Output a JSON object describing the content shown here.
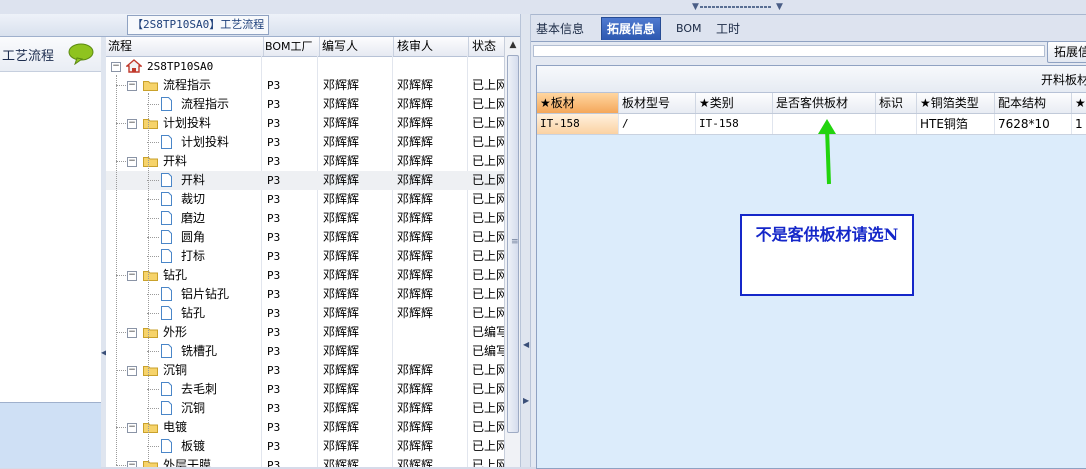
{
  "window": {
    "flow_title": "【2S8TP10SA0】工艺流程"
  },
  "left_panel": {
    "label": "工艺流程"
  },
  "grid": {
    "columns": [
      "流程",
      "BOM工厂",
      "编写人",
      "核审人",
      "状态"
    ],
    "rows": [
      {
        "name": "2S8TP10SA0",
        "bom": "",
        "writer": "",
        "reviewer": "",
        "status": ""
      },
      {
        "name": "流程指示",
        "bom": "P3",
        "writer": "邓辉辉",
        "reviewer": "邓辉辉",
        "status": "已上网"
      },
      {
        "name": "流程指示",
        "bom": "P3",
        "writer": "邓辉辉",
        "reviewer": "邓辉辉",
        "status": "已上网"
      },
      {
        "name": "计划投料",
        "bom": "P3",
        "writer": "邓辉辉",
        "reviewer": "邓辉辉",
        "status": "已上网"
      },
      {
        "name": "计划投料",
        "bom": "P3",
        "writer": "邓辉辉",
        "reviewer": "邓辉辉",
        "status": "已上网"
      },
      {
        "name": "开料",
        "bom": "P3",
        "writer": "邓辉辉",
        "reviewer": "邓辉辉",
        "status": "已上网"
      },
      {
        "name": "开料",
        "bom": "P3",
        "writer": "邓辉辉",
        "reviewer": "邓辉辉",
        "status": "已上网"
      },
      {
        "name": "裁切",
        "bom": "P3",
        "writer": "邓辉辉",
        "reviewer": "邓辉辉",
        "status": "已上网"
      },
      {
        "name": "磨边",
        "bom": "P3",
        "writer": "邓辉辉",
        "reviewer": "邓辉辉",
        "status": "已上网"
      },
      {
        "name": "圆角",
        "bom": "P3",
        "writer": "邓辉辉",
        "reviewer": "邓辉辉",
        "status": "已上网"
      },
      {
        "name": "打标",
        "bom": "P3",
        "writer": "邓辉辉",
        "reviewer": "邓辉辉",
        "status": "已上网"
      },
      {
        "name": "钻孔",
        "bom": "P3",
        "writer": "邓辉辉",
        "reviewer": "邓辉辉",
        "status": "已上网"
      },
      {
        "name": "铝片钻孔",
        "bom": "P3",
        "writer": "邓辉辉",
        "reviewer": "邓辉辉",
        "status": "已上网"
      },
      {
        "name": "钻孔",
        "bom": "P3",
        "writer": "邓辉辉",
        "reviewer": "邓辉辉",
        "status": "已上网"
      },
      {
        "name": "外形",
        "bom": "P3",
        "writer": "邓辉辉",
        "reviewer": "",
        "status": "已编写"
      },
      {
        "name": "铣槽孔",
        "bom": "P3",
        "writer": "邓辉辉",
        "reviewer": "",
        "status": "已编写"
      },
      {
        "name": "沉铜",
        "bom": "P3",
        "writer": "邓辉辉",
        "reviewer": "邓辉辉",
        "status": "已上网"
      },
      {
        "name": "去毛刺",
        "bom": "P3",
        "writer": "邓辉辉",
        "reviewer": "邓辉辉",
        "status": "已上网"
      },
      {
        "name": "沉铜",
        "bom": "P3",
        "writer": "邓辉辉",
        "reviewer": "邓辉辉",
        "status": "已上网"
      },
      {
        "name": "电镀",
        "bom": "P3",
        "writer": "邓辉辉",
        "reviewer": "邓辉辉",
        "status": "已上网"
      },
      {
        "name": "板镀",
        "bom": "P3",
        "writer": "邓辉辉",
        "reviewer": "邓辉辉",
        "status": "已上网"
      },
      {
        "name": "外层干膜",
        "bom": "P3",
        "writer": "邓辉辉",
        "reviewer": "邓辉辉",
        "status": "已上网"
      }
    ]
  },
  "tabs": [
    {
      "label": "基本信息",
      "active": false
    },
    {
      "label": "拓展信息",
      "active": true
    },
    {
      "label": "BOM",
      "active": false
    },
    {
      "label": "工时",
      "active": false
    }
  ],
  "ext": {
    "button_label": "拓展信息",
    "panel_title": "开料板材",
    "columns": [
      "★板材",
      "板材型号",
      "★类别",
      "是否客供板材",
      "标识",
      "★铜箔类型",
      "配本结构",
      "★"
    ],
    "row": [
      "IT-158",
      "/",
      "IT-158",
      "",
      "",
      "HTE铜箔",
      "7628*10",
      "1"
    ]
  },
  "annotation": {
    "text": "不是客供板材请选N",
    "arrow_color": "#22d40e",
    "box_color": "#1527c9"
  }
}
